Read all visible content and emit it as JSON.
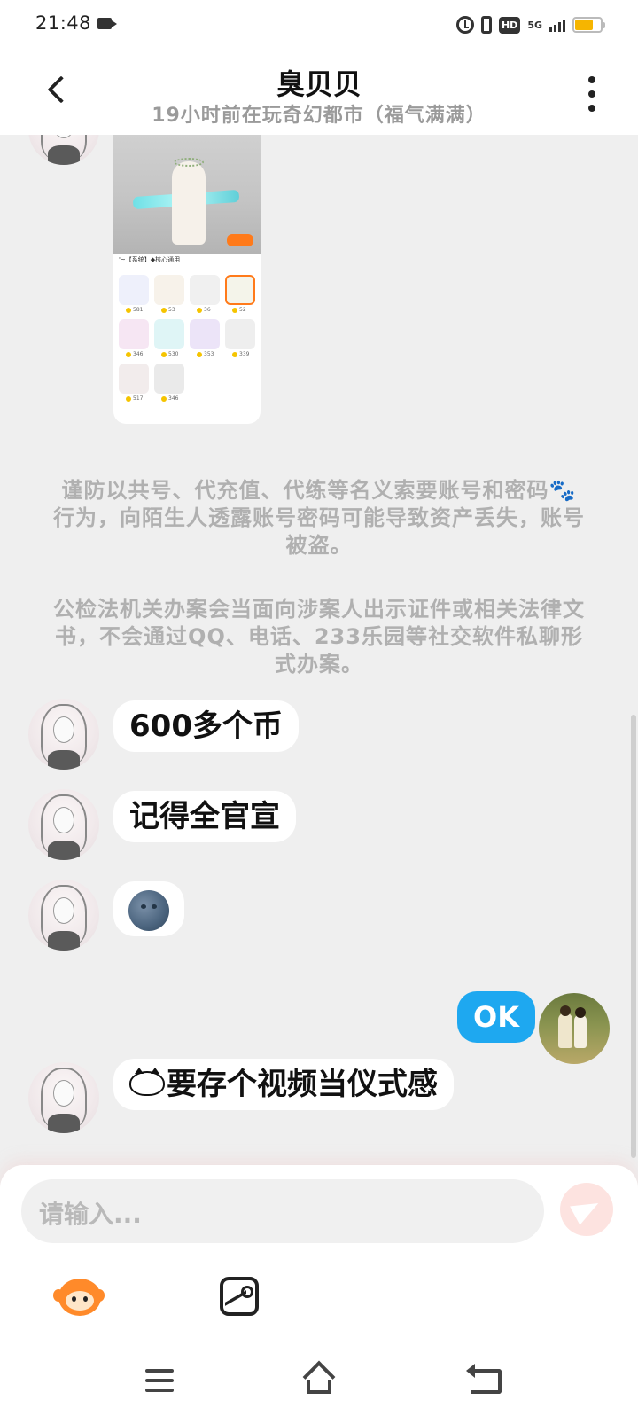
{
  "status_bar": {
    "time": "21:48",
    "network": "5G",
    "hd": "HD"
  },
  "header": {
    "title": "臭贝贝",
    "subtitle": "19小时前在玩奇幻都市（福气满满）"
  },
  "shared_image": {
    "caption": "'~【系统】◆核心通用",
    "prices": [
      "581",
      "53",
      "36",
      "52",
      "346",
      "530",
      "353",
      "339",
      "517",
      "346"
    ]
  },
  "warning": {
    "line1": "谨防以共号、代充值、代练等名义索要账号和密码🐾行为，向陌生人透露账号密码可能导致资产丢失，账号被盗。",
    "line2": "公检法机关办案会当面向涉案人出示证件或相关法律文书，不会通过QQ、电话、233乐园等社交软件私聊形式办案。"
  },
  "messages": {
    "m1": "600多个币",
    "m2": "记得全官宣",
    "m3_icon": "new-moon-face-emoji",
    "m4": "OK",
    "m5": "要存个视频当仪式感"
  },
  "input": {
    "placeholder": "请输入..."
  },
  "colors": {
    "outgoing_bubble": "#1ea8f0",
    "accent": "#ff7a1a",
    "send_button": "#fde3e0"
  }
}
